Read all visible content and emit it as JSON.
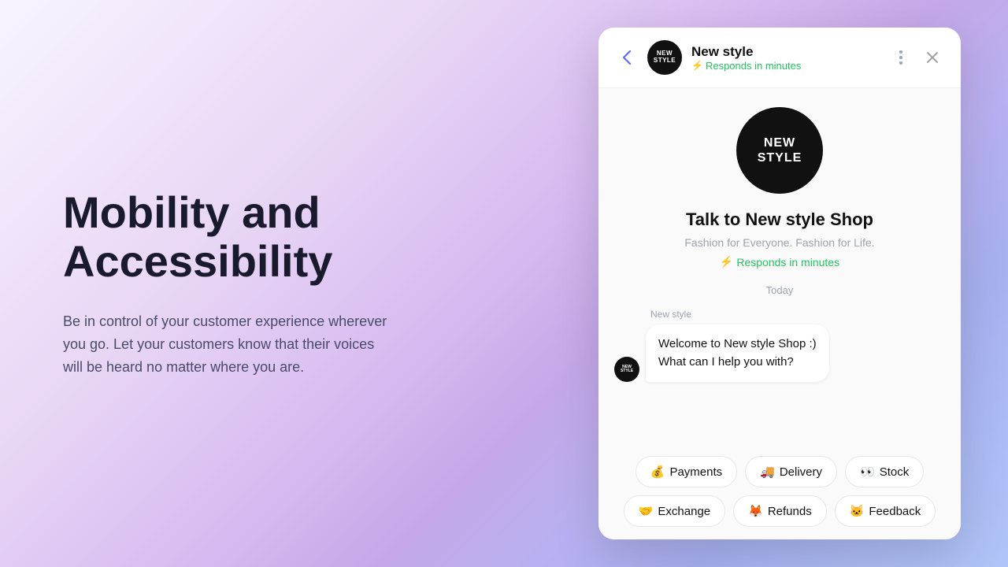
{
  "background": {
    "gradient": "linear-gradient from light purple to medium purple"
  },
  "left": {
    "title_line1": "Mobility and",
    "title_line2": "Accessibility",
    "description": "Be in control of your customer experience wherever you go. Let your customers know that their voices will be heard no matter where you are."
  },
  "chat": {
    "header": {
      "back_label": "‹",
      "shop_name": "New style",
      "status": "⚡ Responds in minutes",
      "more_options_label": "⋮",
      "close_label": "✕",
      "avatar_line1": "NEW",
      "avatar_line2": "STYLE"
    },
    "body": {
      "logo_line1": "NEW",
      "logo_line2": "STYLE",
      "title": "Talk to New style Shop",
      "tagline": "Fashion for Everyone. Fashion for Life.",
      "response_time": "⚡ Responds in minutes",
      "date_label": "Today",
      "sender_label": "New style",
      "welcome_message": "Welcome to New style Shop :)\nWhat can I help you with?"
    },
    "quick_replies_row1": [
      {
        "emoji": "💰",
        "label": "Payments"
      },
      {
        "emoji": "🚚",
        "label": "Delivery"
      },
      {
        "emoji": "👀",
        "label": "Stock"
      }
    ],
    "quick_replies_row2": [
      {
        "emoji": "🤝",
        "label": "Exchange"
      },
      {
        "emoji": "🦊",
        "label": "Refunds"
      },
      {
        "emoji": "🐱",
        "label": "Feedback"
      }
    ]
  }
}
